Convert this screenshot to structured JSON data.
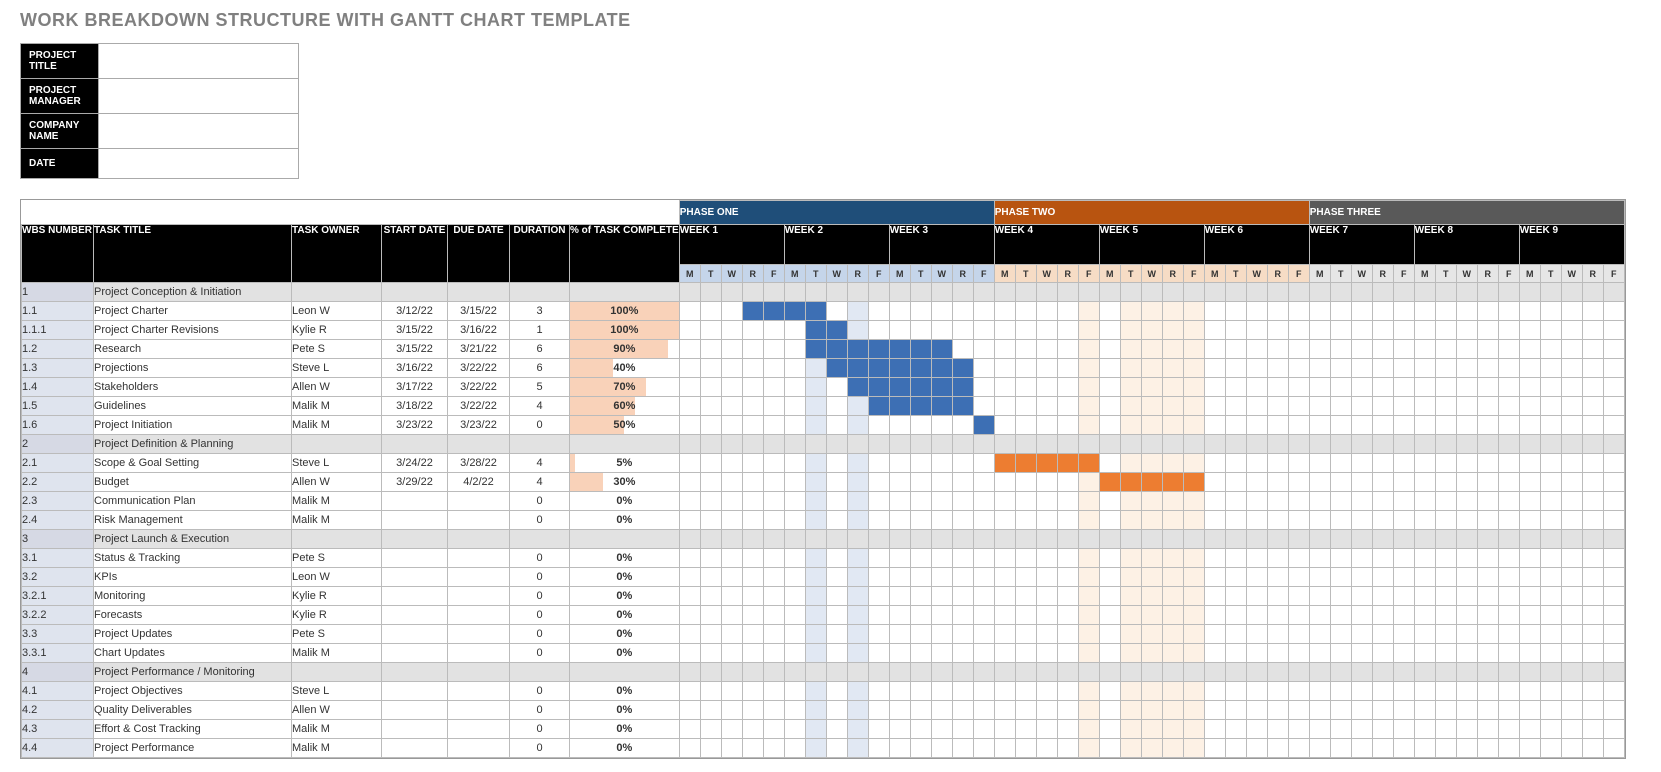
{
  "title": "WORK BREAKDOWN STRUCTURE WITH GANTT CHART TEMPLATE",
  "info": [
    {
      "label": "PROJECT TITLE",
      "value": ""
    },
    {
      "label": "PROJECT MANAGER",
      "value": ""
    },
    {
      "label": "COMPANY NAME",
      "value": ""
    },
    {
      "label": "DATE",
      "value": ""
    }
  ],
  "columns": [
    "WBS NUMBER",
    "TASK TITLE",
    "TASK OWNER",
    "START DATE",
    "DUE DATE",
    "DURATION",
    "% of TASK COMPLETE"
  ],
  "phases": [
    {
      "label": "PHASE ONE",
      "weeks": [
        "WEEK 1",
        "WEEK 2",
        "WEEK 3"
      ],
      "cls": "1"
    },
    {
      "label": "PHASE TWO",
      "weeks": [
        "WEEK 4",
        "WEEK 5",
        "WEEK 6"
      ],
      "cls": "2"
    },
    {
      "label": "PHASE THREE",
      "weeks": [
        "WEEK 7",
        "WEEK 8",
        "WEEK 9"
      ],
      "cls": "3"
    }
  ],
  "dow": [
    "M",
    "T",
    "W",
    "R",
    "F"
  ],
  "chart_data": {
    "type": "gantt",
    "timeline_days": 45,
    "tasks": [
      {
        "wbs": "1",
        "title": "Project Conception & Initiation",
        "owner": "",
        "start": "",
        "due": "",
        "dur": "",
        "pct": "",
        "section": true
      },
      {
        "wbs": "1.1",
        "title": "Project Charter",
        "owner": "Leon W",
        "start": "3/12/22",
        "due": "3/15/22",
        "dur": "3",
        "pct": "100%",
        "bars": [
          [
            4,
            7,
            1
          ]
        ]
      },
      {
        "wbs": "1.1.1",
        "title": "Project Charter Revisions",
        "owner": "Kylie R",
        "start": "3/15/22",
        "due": "3/16/22",
        "dur": "1",
        "pct": "100%",
        "bars": [
          [
            7,
            8,
            1
          ]
        ]
      },
      {
        "wbs": "1.2",
        "title": "Research",
        "owner": "Pete S",
        "start": "3/15/22",
        "due": "3/21/22",
        "dur": "6",
        "pct": "90%",
        "bars": [
          [
            7,
            13,
            1
          ]
        ]
      },
      {
        "wbs": "1.3",
        "title": "Projections",
        "owner": "Steve L",
        "start": "3/16/22",
        "due": "3/22/22",
        "dur": "6",
        "pct": "40%",
        "bars": [
          [
            8,
            14,
            1
          ]
        ]
      },
      {
        "wbs": "1.4",
        "title": "Stakeholders",
        "owner": "Allen W",
        "start": "3/17/22",
        "due": "3/22/22",
        "dur": "5",
        "pct": "70%",
        "bars": [
          [
            9,
            14,
            1
          ]
        ]
      },
      {
        "wbs": "1.5",
        "title": "Guidelines",
        "owner": "Malik M",
        "start": "3/18/22",
        "due": "3/22/22",
        "dur": "4",
        "pct": "60%",
        "bars": [
          [
            10,
            14,
            1
          ]
        ]
      },
      {
        "wbs": "1.6",
        "title": "Project Initiation",
        "owner": "Malik M",
        "start": "3/23/22",
        "due": "3/23/22",
        "dur": "0",
        "pct": "50%",
        "bars": [
          [
            15,
            15,
            1
          ]
        ]
      },
      {
        "wbs": "2",
        "title": "Project Definition & Planning",
        "owner": "",
        "start": "",
        "due": "",
        "dur": "",
        "pct": "",
        "section": true
      },
      {
        "wbs": "2.1",
        "title": "Scope & Goal Setting",
        "owner": "Steve L",
        "start": "3/24/22",
        "due": "3/28/22",
        "dur": "4",
        "pct": "5%",
        "bars": [
          [
            16,
            20,
            2
          ]
        ]
      },
      {
        "wbs": "2.2",
        "title": "Budget",
        "owner": "Allen W",
        "start": "3/29/22",
        "due": "4/2/22",
        "dur": "4",
        "pct": "30%",
        "bars": [
          [
            21,
            25,
            2
          ]
        ]
      },
      {
        "wbs": "2.3",
        "title": "Communication Plan",
        "owner": "Malik M",
        "start": "",
        "due": "",
        "dur": "0",
        "pct": "0%"
      },
      {
        "wbs": "2.4",
        "title": "Risk Management",
        "owner": "Malik M",
        "start": "",
        "due": "",
        "dur": "0",
        "pct": "0%"
      },
      {
        "wbs": "3",
        "title": "Project Launch & Execution",
        "owner": "",
        "start": "",
        "due": "",
        "dur": "",
        "pct": "",
        "section": true
      },
      {
        "wbs": "3.1",
        "title": "Status & Tracking",
        "owner": "Pete S",
        "start": "",
        "due": "",
        "dur": "0",
        "pct": "0%"
      },
      {
        "wbs": "3.2",
        "title": "KPIs",
        "owner": "Leon W",
        "start": "",
        "due": "",
        "dur": "0",
        "pct": "0%"
      },
      {
        "wbs": "3.2.1",
        "title": "Monitoring",
        "owner": "Kylie R",
        "start": "",
        "due": "",
        "dur": "0",
        "pct": "0%"
      },
      {
        "wbs": "3.2.2",
        "title": "Forecasts",
        "owner": "Kylie R",
        "start": "",
        "due": "",
        "dur": "0",
        "pct": "0%"
      },
      {
        "wbs": "3.3",
        "title": "Project Updates",
        "owner": "Pete S",
        "start": "",
        "due": "",
        "dur": "0",
        "pct": "0%"
      },
      {
        "wbs": "3.3.1",
        "title": "Chart Updates",
        "owner": "Malik M",
        "start": "",
        "due": "",
        "dur": "0",
        "pct": "0%"
      },
      {
        "wbs": "4",
        "title": "Project Performance / Monitoring",
        "owner": "",
        "start": "",
        "due": "",
        "dur": "",
        "pct": "",
        "section": true
      },
      {
        "wbs": "4.1",
        "title": "Project Objectives",
        "owner": "Steve L",
        "start": "",
        "due": "",
        "dur": "0",
        "pct": "0%"
      },
      {
        "wbs": "4.2",
        "title": "Quality Deliverables",
        "owner": "Allen W",
        "start": "",
        "due": "",
        "dur": "0",
        "pct": "0%"
      },
      {
        "wbs": "4.3",
        "title": "Effort & Cost Tracking",
        "owner": "Malik M",
        "start": "",
        "due": "",
        "dur": "0",
        "pct": "0%"
      },
      {
        "wbs": "4.4",
        "title": "Project Performance",
        "owner": "Malik M",
        "start": "",
        "due": "",
        "dur": "0",
        "pct": "0%"
      }
    ],
    "light_columns": {
      "1": [
        [
          7,
          7
        ],
        [
          9,
          9
        ]
      ],
      "2": [
        [
          20,
          20
        ],
        [
          22,
          25
        ]
      ]
    }
  }
}
